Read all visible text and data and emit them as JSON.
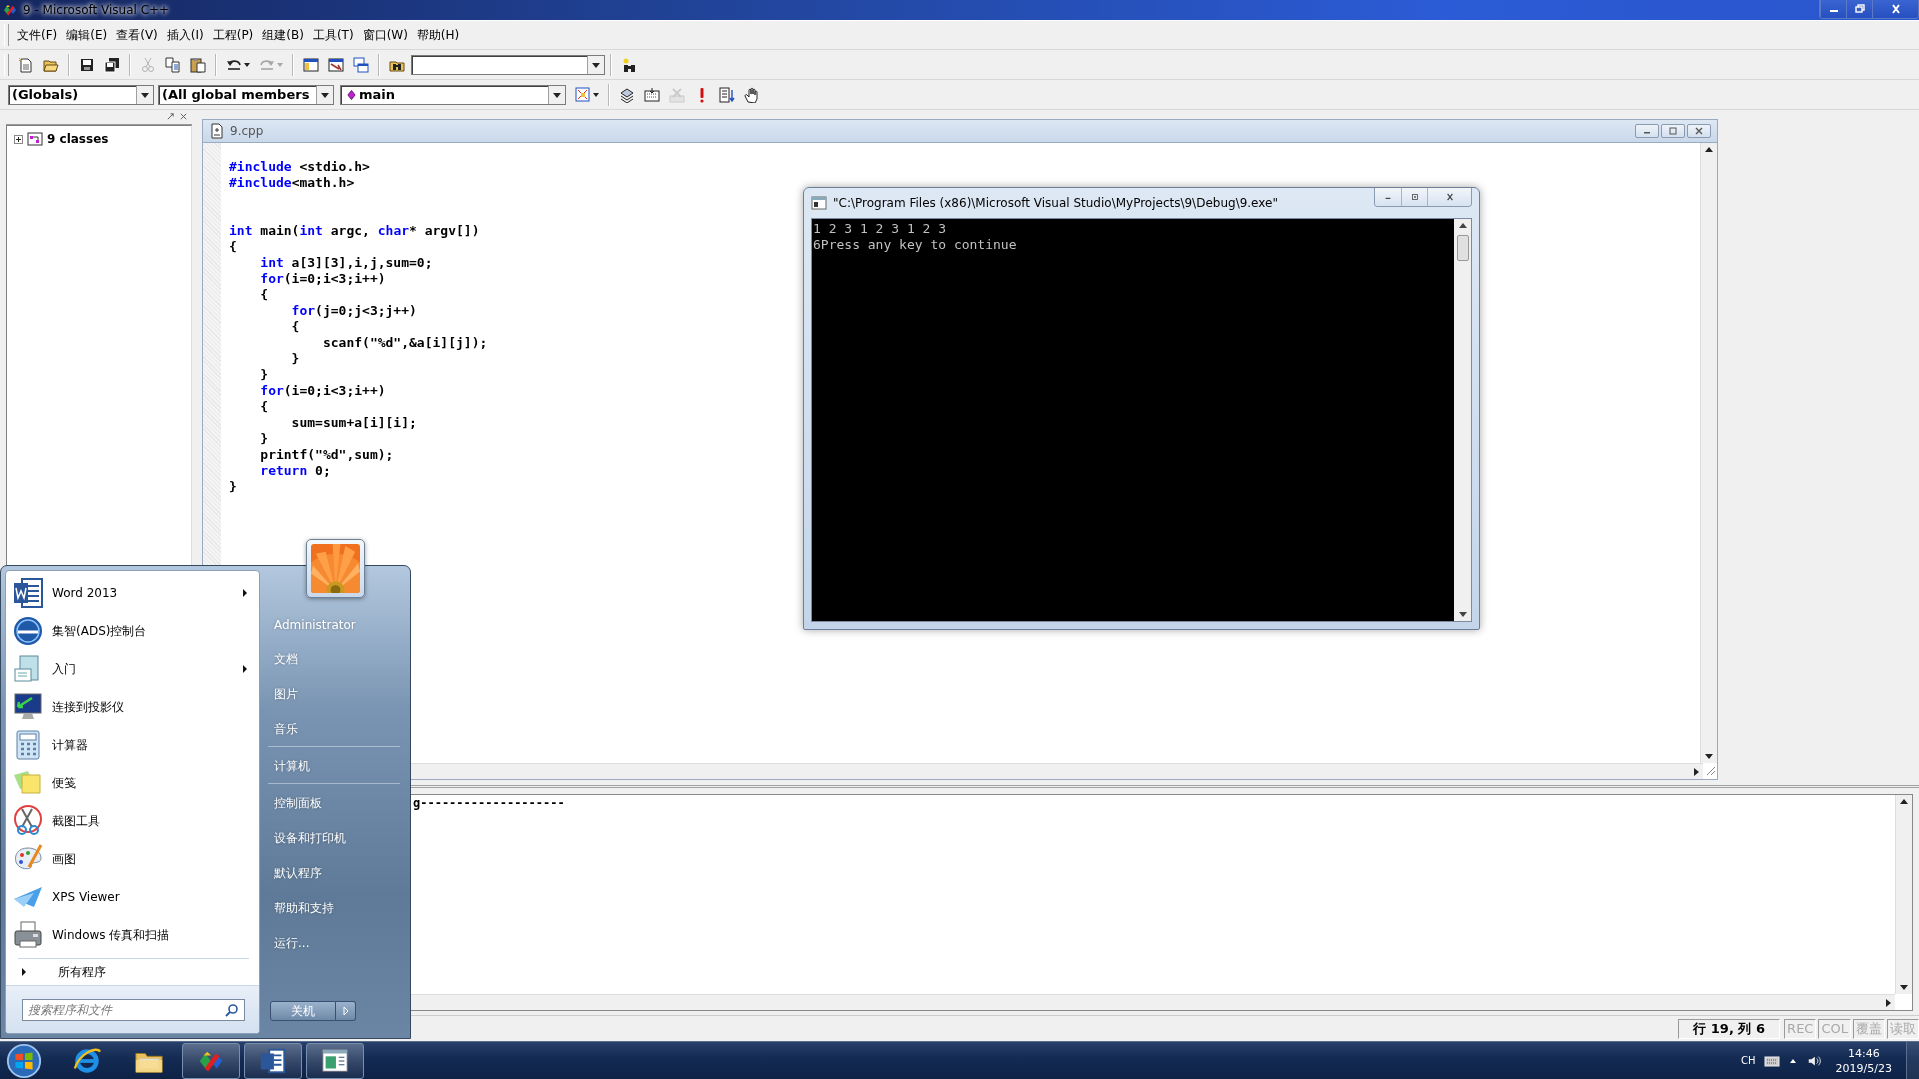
{
  "window": {
    "title": "9 - Microsoft Visual C++"
  },
  "menu": [
    "文件(F)",
    "编辑(E)",
    "查看(V)",
    "插入(I)",
    "工程(P)",
    "组建(B)",
    "工具(T)",
    "窗口(W)",
    "帮助(H)"
  ],
  "toolbar": [
    {
      "disabled": false
    },
    {
      "disabled": false
    },
    {
      "disabled": false
    },
    {
      "disabled": false
    },
    {
      "disabled": true
    },
    {
      "disabled": false
    },
    {
      "disabled": false
    },
    {
      "disabled": false
    },
    {
      "disabled": true
    },
    {
      "disabled": false
    },
    {
      "disabled": false
    },
    {
      "disabled": false
    },
    {
      "disabled": false
    },
    {
      "disabled": false
    }
  ],
  "wizard_bar": {
    "class": "(Globals)",
    "members": "(All global members",
    "function": "main",
    "buttons": [
      {
        "disabled": false
      },
      {
        "disabled": false
      },
      {
        "disabled": false
      },
      {
        "disabled": true
      },
      {
        "disabled": false
      },
      {
        "disabled": false
      },
      {
        "disabled": false
      }
    ]
  },
  "workspace": {
    "tree": [
      {
        "label": "9 classes",
        "expanded": false
      }
    ]
  },
  "editor": {
    "title": "9.cpp",
    "lines": [
      {
        "kind": "code",
        "tokens": [
          {
            "kind": "keyword",
            "text": "#include"
          },
          {
            "kind": "text",
            "text": " <stdio.h>"
          }
        ]
      },
      {
        "kind": "code",
        "tokens": [
          {
            "kind": "keyword",
            "text": "#include"
          },
          {
            "kind": "text",
            "text": "<math.h>"
          }
        ]
      },
      {
        "kind": "blank"
      },
      {
        "kind": "blank"
      },
      {
        "kind": "code",
        "tokens": [
          {
            "kind": "keyword",
            "text": "int"
          },
          {
            "kind": "text",
            "text": " main("
          },
          {
            "kind": "keyword",
            "text": "int"
          },
          {
            "kind": "text",
            "text": " argc, "
          },
          {
            "kind": "keyword",
            "text": "char"
          },
          {
            "kind": "text",
            "text": "* argv[])"
          }
        ]
      },
      {
        "kind": "code",
        "tokens": [
          {
            "kind": "text",
            "text": "{"
          }
        ]
      },
      {
        "kind": "code",
        "tokens": [
          {
            "kind": "keyword",
            "text": "    int"
          },
          {
            "kind": "text",
            "text": " a[3][3],i,j,sum=0;"
          }
        ]
      },
      {
        "kind": "code",
        "tokens": [
          {
            "kind": "keyword",
            "text": "    for"
          },
          {
            "kind": "text",
            "text": "(i=0;i<3;i++)"
          }
        ]
      },
      {
        "kind": "code",
        "tokens": [
          {
            "kind": "text",
            "text": "    {"
          }
        ]
      },
      {
        "kind": "code",
        "tokens": [
          {
            "kind": "keyword",
            "text": "        for"
          },
          {
            "kind": "text",
            "text": "(j=0;j<3;j++)"
          }
        ]
      },
      {
        "kind": "code",
        "tokens": [
          {
            "kind": "text",
            "text": "        {"
          }
        ]
      },
      {
        "kind": "code",
        "tokens": [
          {
            "kind": "text",
            "text": "            scanf(\"%d\",&a[i][j]);"
          }
        ]
      },
      {
        "kind": "code",
        "tokens": [
          {
            "kind": "text",
            "text": "        }"
          }
        ]
      },
      {
        "kind": "code",
        "tokens": [
          {
            "kind": "text",
            "text": "    }"
          }
        ]
      },
      {
        "kind": "code",
        "tokens": [
          {
            "kind": "keyword",
            "text": "    for"
          },
          {
            "kind": "text",
            "text": "(i=0;i<3;i++)"
          }
        ]
      },
      {
        "kind": "code",
        "tokens": [
          {
            "kind": "text",
            "text": "    {"
          }
        ]
      },
      {
        "kind": "code",
        "tokens": [
          {
            "kind": "text",
            "text": "        sum=sum+a[i][i];"
          }
        ]
      },
      {
        "kind": "code",
        "tokens": [
          {
            "kind": "text",
            "text": "    }"
          }
        ]
      },
      {
        "kind": "code",
        "tokens": [
          {
            "kind": "text",
            "text": "    printf(\"%d\",sum);"
          }
        ]
      },
      {
        "kind": "code",
        "tokens": [
          {
            "kind": "keyword",
            "text": "    return"
          },
          {
            "kind": "text",
            "text": " 0;"
          }
        ]
      },
      {
        "kind": "code",
        "tokens": [
          {
            "kind": "text",
            "text": "}"
          }
        ]
      }
    ]
  },
  "console": {
    "title": "\"C:\\Program Files (x86)\\Microsoft Visual Studio\\MyProjects\\9\\Debug\\9.exe\"",
    "lines": [
      "1 2 3 1 2 3 1 2 3",
      "6Press any key to continue"
    ]
  },
  "output": {
    "lines": [
      "g--------------------"
    ]
  },
  "status_bar": {
    "position": "行 19, 列 6",
    "indicators": [
      {
        "label": "REC",
        "on": false
      },
      {
        "label": "COL",
        "on": false
      },
      {
        "label": "覆盖",
        "on": false
      },
      {
        "label": "读取",
        "on": false
      }
    ]
  },
  "start_menu": {
    "programs": [
      {
        "label": "Word 2013",
        "submenu": true
      },
      {
        "label": "集智(ADS)控制台",
        "submenu": false
      },
      {
        "label": "入门",
        "submenu": true
      },
      {
        "label": "连接到投影仪",
        "submenu": false
      },
      {
        "label": "计算器",
        "submenu": false
      },
      {
        "label": "便笺",
        "submenu": false
      },
      {
        "label": "截图工具",
        "submenu": false
      },
      {
        "label": "画图",
        "submenu": false
      },
      {
        "label": "XPS Viewer",
        "submenu": false
      },
      {
        "label": "Windows 传真和扫描",
        "submenu": false
      }
    ],
    "all_programs": "所有程序",
    "search": {
      "placeholder": "搜索程序和文件"
    },
    "places": [
      {
        "label": "Administrator",
        "divider_after": false
      },
      {
        "label": "文档",
        "divider_after": false
      },
      {
        "label": "图片",
        "divider_after": false
      },
      {
        "label": "音乐",
        "divider_after": true
      },
      {
        "label": "计算机",
        "divider_after": true
      },
      {
        "label": "控制面板",
        "divider_after": false
      },
      {
        "label": "设备和打印机",
        "divider_after": false
      },
      {
        "label": "默认程序",
        "divider_after": false
      },
      {
        "label": "帮助和支持",
        "divider_after": false
      },
      {
        "label": "运行...",
        "divider_after": false
      }
    ],
    "shutdown": "关机"
  },
  "taskbar": {
    "apps": [
      {
        "running": false
      },
      {
        "running": false
      },
      {
        "running": true
      },
      {
        "running": true
      },
      {
        "running": true
      }
    ],
    "tray": {
      "language": "CH",
      "time": "14:46",
      "date": "2019/5/23"
    }
  }
}
